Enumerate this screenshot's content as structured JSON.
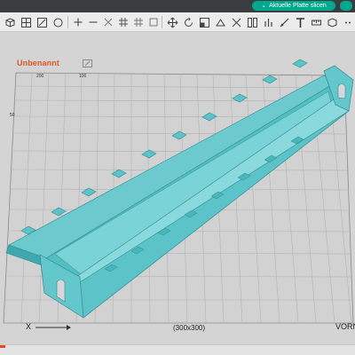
{
  "window": {
    "slice_button_label": "Aktuelle Platte slicen",
    "slice_button_chevron": "⌄"
  },
  "toolbar": {
    "icons": [
      "box-icon",
      "grid-icon",
      "arrange-icon",
      "orient-icon",
      "add-plate-icon",
      "remove-plate-icon",
      "reset-icon",
      "grid-fine-icon",
      "move-icon",
      "rotate-icon",
      "scale-icon",
      "cut-icon",
      "split-icon",
      "support-icon",
      "seam-icon",
      "text-icon",
      "measure-icon",
      "assembly-icon"
    ]
  },
  "plate": {
    "name": "Unbenannt",
    "size_label": "(300x300)",
    "x_axis_label": "X",
    "front_label": "VORN",
    "tick_200": "200",
    "tick_100": "100",
    "tick_50": "50"
  },
  "colors": {
    "model_fill": "#5cc4c8",
    "model_shadow": "#3ea8ad",
    "model_edge": "#2f8c91",
    "grid_line": "#b3b3b3",
    "plate_bg": "#d2d2d2",
    "title_accent": "#e0572a",
    "slice_button": "#00a88e"
  }
}
